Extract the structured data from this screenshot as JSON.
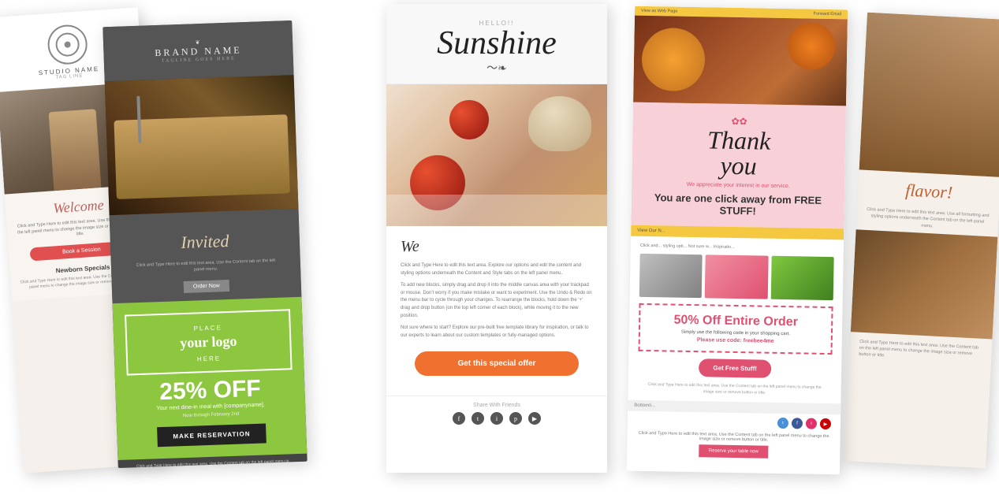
{
  "scene": {
    "background": "#ffffff"
  },
  "card1": {
    "logo_text": "STUDIO NAME",
    "tagline": "TAG LINE",
    "welcome": "Welcome",
    "body_text": "Click and Type Here to edit this text area. Use the Content tab on the left panel menu to change the image size or remove button or title.",
    "btn_book": "Book a Session",
    "newborn_title": "Newborn Specials",
    "newborn_body": "Click and Type Here to edit this text area. Use the Content tab on the left panel menu to change the image size or remove button or title."
  },
  "card2": {
    "ornament": "❦",
    "brand_name": "BRAND NAME",
    "brand_sub": "TAGLINE GOES HERE",
    "invited": "Invited",
    "invite_body": "Click and Type Here to edit this text area. Use the Content tab on the left panel menu.",
    "place_text": "PLACE",
    "logo_main": "your logo",
    "here_text": "HERE",
    "discount": "25% OFF",
    "meal_desc": "Your next dine-in meal with [companyname].",
    "meal_date": "Now through February 2nd",
    "btn_reserve": "Make Reservation",
    "more_text": "Click and Type Here to edit this text area. Use the Content tab on the left panel menu to change the image size or remove button or title."
  },
  "card3": {
    "hello": "HELLO!!",
    "sunshine": "Sunshine",
    "swirl": "~",
    "we_text": "We",
    "body1": "Click and Type Here to edit this text area. Explore our options and edit the content and styling options underneath the Content and Style tabs on the left panel menu.",
    "body2": "To add new blocks, simply drag and drop it into the middle canvas area with your trackpad or mouse. Don't worry if you make mistake or want to experiment. Use the Undo & Redo on the menu bar to cycle through your changes. To rearrange the blocks, hold down the '+' drag and drop button (on the top left corner of each block), while moving it to the new position.",
    "body3": "Not sure where to start? Explore our pre-built free template library for inspiration, or talk to our experts to learn about our custom templates or fully-managed options.",
    "btn_offer": "Get this special offer",
    "share_label": "Share With Friends",
    "social_icons": [
      "f",
      "t",
      "i",
      "p",
      "▶"
    ]
  },
  "card4": {
    "top_link_left": "View as Web Page",
    "top_link_right": "Forward Email",
    "nav_text": "View Our N...",
    "thank_you": "Thank",
    "you": "you",
    "flowers": "✿✿",
    "appreciate": "We appreciate your interest in our service.",
    "free_title": "You are one click away from FREE STUFF!",
    "click_text": "Click and... styling opti... Not sure w... Inspiratio...",
    "coupon_title": "50% Off Entire Order",
    "coupon_body": "Simply use the following code in your shopping cart.",
    "coupon_code_label": "Please use code:",
    "coupon_code": "freebee4me",
    "btn_free": "Get Free Stuff!",
    "bottom_text": "Click and Type Here to edit this text area. Use the Content tab on the left panel menu to change the image size or remove button or title.",
    "bottom_bar": "Bottomli...",
    "table_btn": "Reserve your table now",
    "social_icons2": [
      "tw",
      "fb",
      "in",
      "yt"
    ]
  },
  "card5": {
    "flavor_title": "flavor!",
    "flavor_body": "Click and Type Here to edit this text area. Use all formatting and styling options underneath the Content tab on the left panel menu.",
    "flavor_body2": "Click and Type Here to edit this text area. Use the Content tab on the left panel menu to change the image size or remove button or title."
  }
}
